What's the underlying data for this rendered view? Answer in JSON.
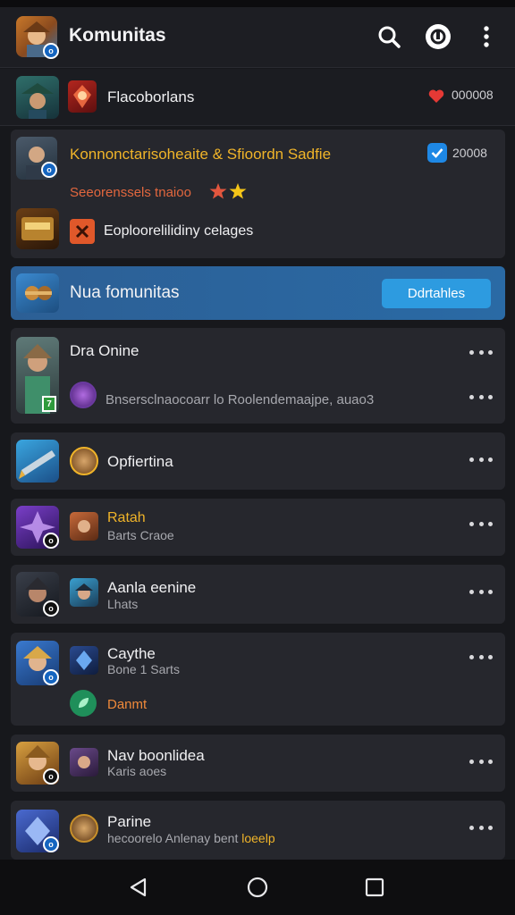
{
  "appbar": {
    "title": "Komunitas"
  },
  "featured": {
    "title": "Flacoborlans",
    "count": "000008"
  },
  "highlight": {
    "title": "Konnonctarisoheaite & Sfioordn Sadfie",
    "count": "20008",
    "subtitle": "Seeorenssels tnaioo",
    "sub_item": "Eoploorelilidiny celages"
  },
  "join": {
    "title": "Nua fomunitas",
    "button": "Ddrtahles"
  },
  "communities": [
    {
      "title": "Dra Onine",
      "subtitle": "Bnsersclnaocoarr lo Roolendemaajpe, auao3"
    },
    {
      "title": "Opfiertina"
    },
    {
      "title": "Ratah",
      "subtitle": "Barts Craoe"
    },
    {
      "title": "Aanla eenine",
      "subtitle": "Lhats"
    },
    {
      "title": "Caythe",
      "subtitle": "Bone 1 Sarts",
      "extra": "Danmt"
    },
    {
      "title": "Nav boonlidea",
      "subtitle": "Karis aoes"
    },
    {
      "title": "Parine",
      "subtitle_a": "hecoorelo Anlenay bent",
      "subtitle_b": "loeelp"
    }
  ],
  "colors": {
    "accent_gold": "#f0b429",
    "accent_blue": "#2d8ccf",
    "heart": "#e53935",
    "verified": "#1e88e5"
  }
}
